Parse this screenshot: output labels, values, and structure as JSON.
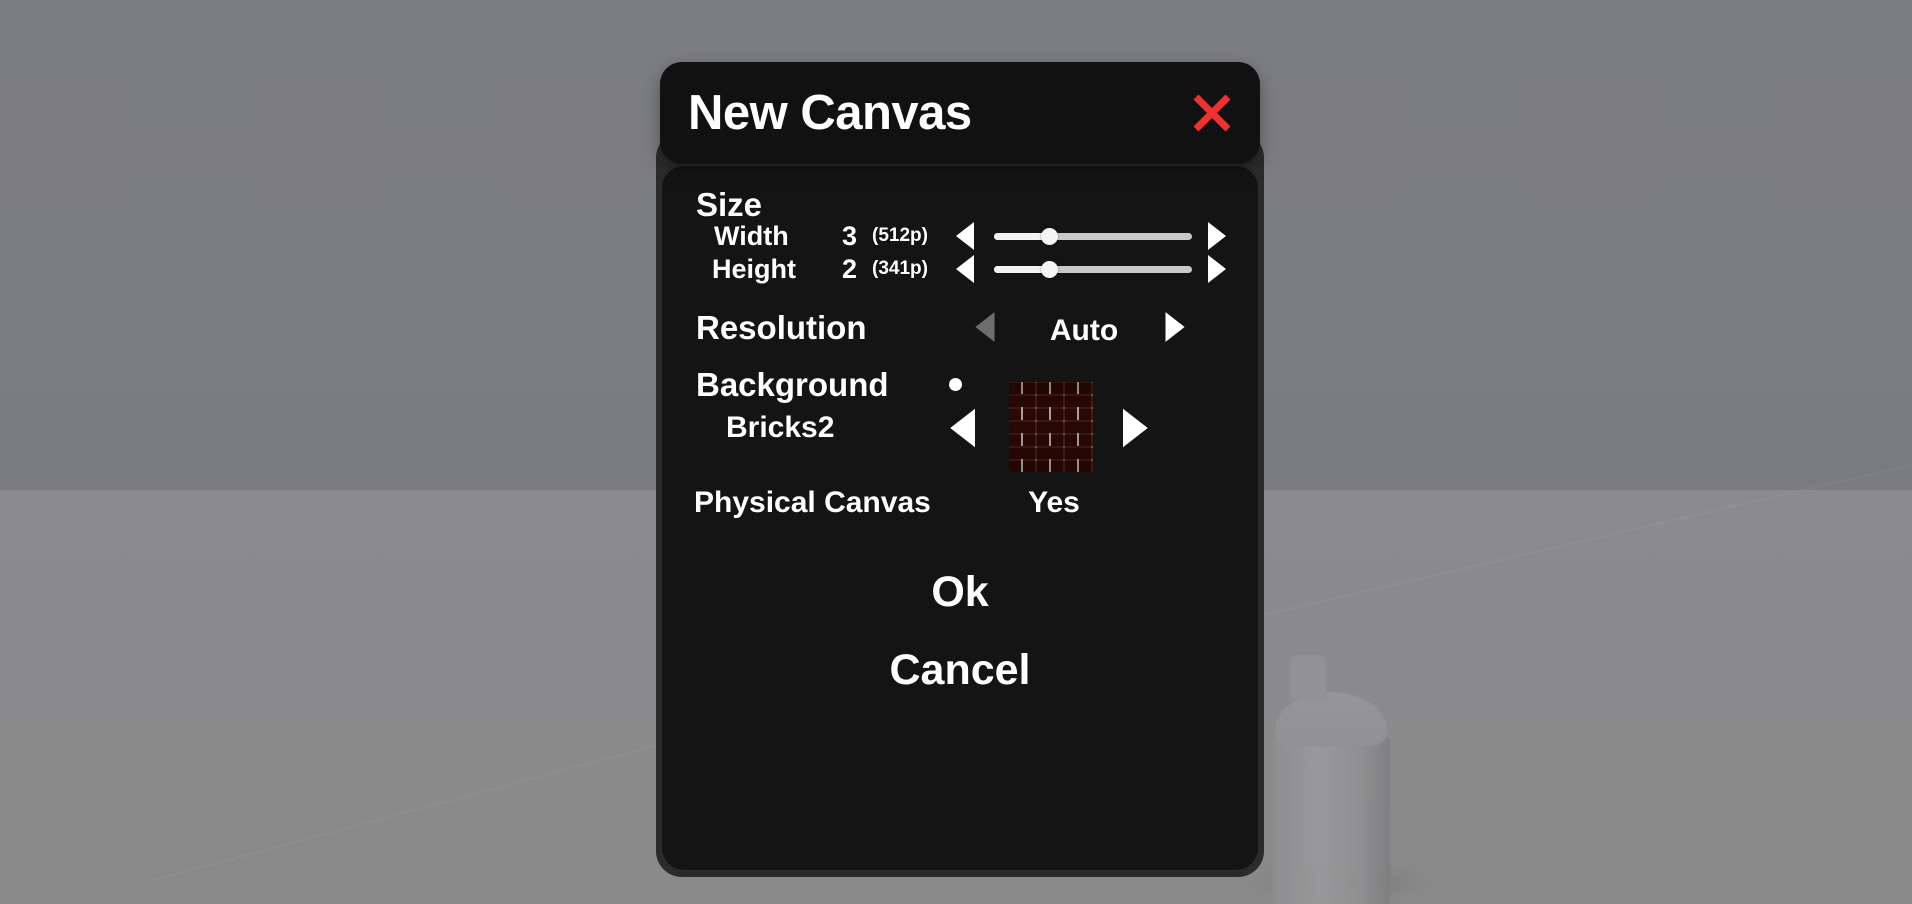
{
  "dialog": {
    "title": "New Canvas",
    "close_icon": "close-x-icon",
    "accent_close_color": "#f23030",
    "panel_color": "#141415"
  },
  "size": {
    "section_label": "Size",
    "width": {
      "label": "Width",
      "value": "3",
      "pixels": "(512p)",
      "slider_percent": 28,
      "dec_arrow": "chevron-left-icon",
      "inc_arrow": "chevron-right-icon"
    },
    "height": {
      "label": "Height",
      "value": "2",
      "pixels": "(341p)",
      "slider_percent": 28,
      "dec_arrow": "chevron-left-icon",
      "inc_arrow": "chevron-right-icon"
    }
  },
  "resolution": {
    "label": "Resolution",
    "value": "Auto",
    "prev_arrow": "chevron-left-icon",
    "next_arrow": "chevron-right-icon",
    "prev_disabled": true
  },
  "background": {
    "label": "Background",
    "indicator": "selected-dot-icon",
    "texture_name": "Bricks2",
    "swatch_icon": "brick-texture-swatch",
    "prev_arrow": "chevron-left-icon",
    "next_arrow": "chevron-right-icon"
  },
  "physical_canvas": {
    "label": "Physical Canvas",
    "value": "Yes"
  },
  "actions": {
    "ok": "Ok",
    "cancel": "Cancel"
  }
}
